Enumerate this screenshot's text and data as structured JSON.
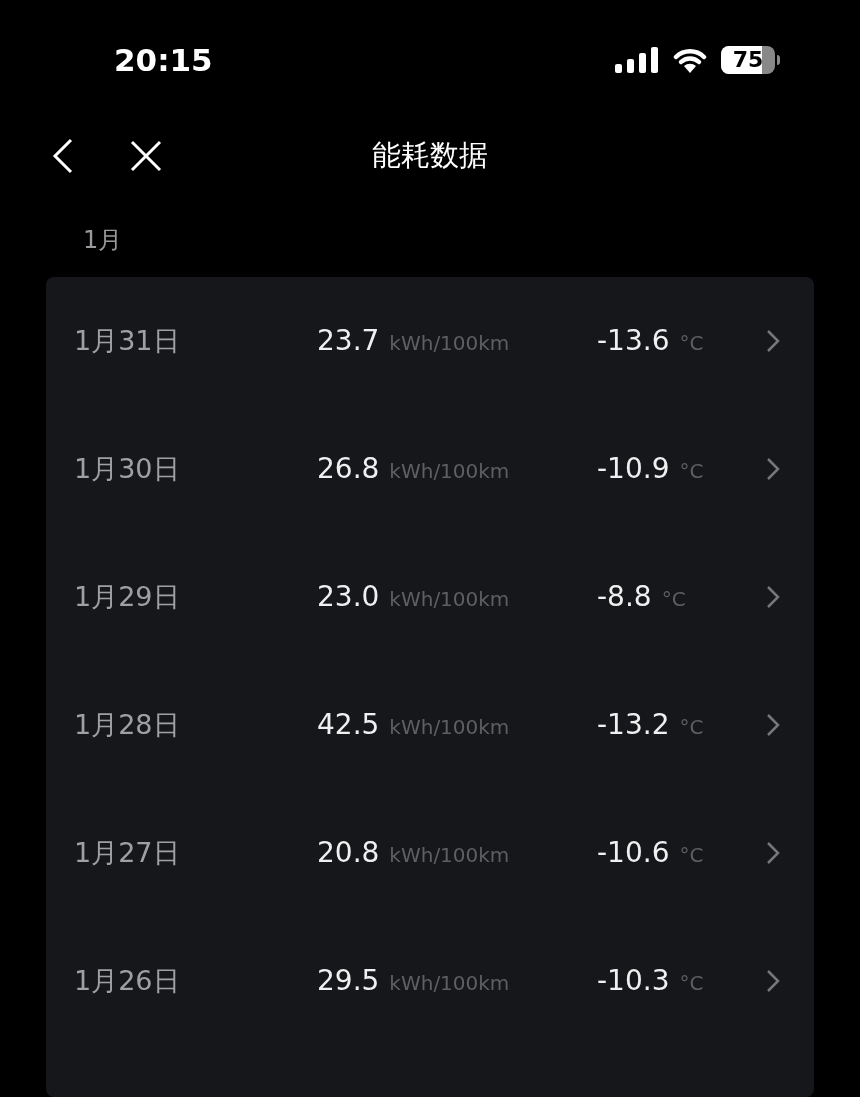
{
  "status_bar": {
    "time": "20:15",
    "battery": "75"
  },
  "nav": {
    "title": "能耗数据"
  },
  "section": {
    "label": "1月"
  },
  "rows": [
    {
      "date": "1月31日",
      "consumption": "23.7",
      "consumption_unit": "kWh/100km",
      "temperature": "-13.6",
      "temperature_unit": "°C"
    },
    {
      "date": "1月30日",
      "consumption": "26.8",
      "consumption_unit": "kWh/100km",
      "temperature": "-10.9",
      "temperature_unit": "°C"
    },
    {
      "date": "1月29日",
      "consumption": "23.0",
      "consumption_unit": "kWh/100km",
      "temperature": "-8.8",
      "temperature_unit": "°C"
    },
    {
      "date": "1月28日",
      "consumption": "42.5",
      "consumption_unit": "kWh/100km",
      "temperature": "-13.2",
      "temperature_unit": "°C"
    },
    {
      "date": "1月27日",
      "consumption": "20.8",
      "consumption_unit": "kWh/100km",
      "temperature": "-10.6",
      "temperature_unit": "°C"
    },
    {
      "date": "1月26日",
      "consumption": "29.5",
      "consumption_unit": "kWh/100km",
      "temperature": "-10.3",
      "temperature_unit": "°C"
    }
  ]
}
